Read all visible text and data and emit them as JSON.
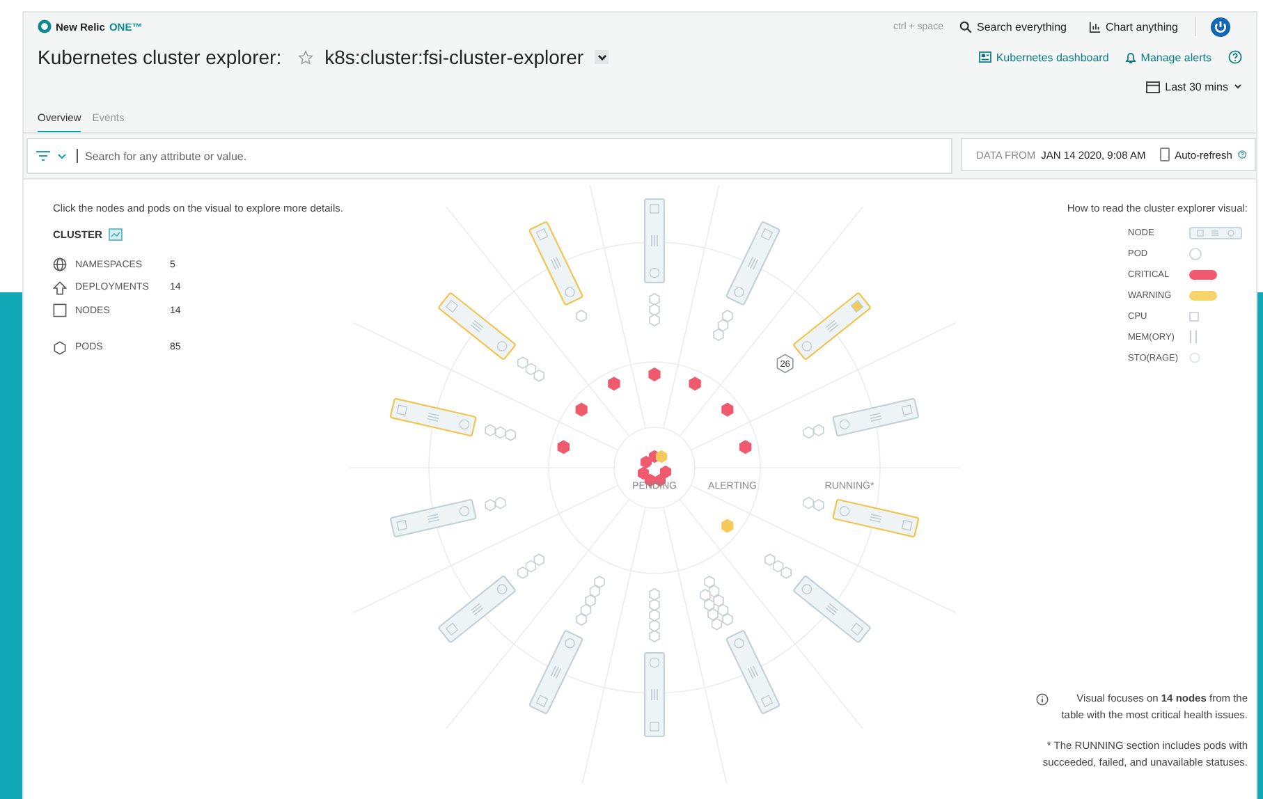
{
  "header": {
    "brand": "New Relic",
    "product": "ONE™",
    "shortcut": "ctrl + space",
    "search": "Search everything",
    "chart": "Chart anything"
  },
  "title": {
    "label": "Kubernetes cluster explorer:",
    "entity": "k8s:cluster:fsi-cluster-explorer",
    "starred": false
  },
  "links": [
    "Kubernetes dashboard",
    "Manage alerts"
  ],
  "time_range": "Last 30 mins",
  "tabs": [
    {
      "label": "Overview",
      "selected": true
    },
    {
      "label": "Events",
      "selected": false
    }
  ],
  "filter": {
    "placeholder": "Search for any attribute or value."
  },
  "data_from": {
    "label": "DATA FROM",
    "value": "JAN 14 2020, 9:08 AM"
  },
  "auto_refresh": {
    "label": "Auto-refresh",
    "checked": false
  },
  "intro": "Click the nodes and pods on the visual to explore more details.",
  "cluster": {
    "title": "CLUSTER",
    "stats": [
      {
        "kind": "namespaces",
        "label": "NAMESPACES",
        "value": "5"
      },
      {
        "kind": "deployments",
        "label": "DEPLOYMENTS",
        "value": "14"
      },
      {
        "kind": "nodes",
        "label": "NODES",
        "value": "14"
      },
      {
        "kind": "pods",
        "label": "PODS",
        "value": "85"
      }
    ]
  },
  "diagram": {
    "sections": [
      "PENDING",
      "ALERTING",
      "RUNNING*"
    ],
    "nodes": [
      {
        "warning": false,
        "cpu_alert": false,
        "critical_pod": true
      },
      {
        "warning": false,
        "cpu_alert": false,
        "critical_pod": true
      },
      {
        "warning": true,
        "cpu_alert": true,
        "critical_pod": true,
        "badge": "26"
      },
      {
        "warning": false,
        "cpu_alert": false,
        "critical_pod": true
      },
      {
        "warning": true,
        "cpu_alert": false
      },
      {
        "warning": false,
        "cpu_alert": false,
        "warning_pod": true
      },
      {
        "warning": false,
        "cpu_alert": false
      },
      {
        "warning": false,
        "cpu_alert": false
      },
      {
        "warning": false,
        "cpu_alert": false
      },
      {
        "warning": false,
        "cpu_alert": false
      },
      {
        "warning": false,
        "cpu_alert": false
      },
      {
        "warning": true,
        "cpu_alert": false,
        "critical_pod": true
      },
      {
        "warning": true,
        "cpu_alert": false,
        "critical_pod": true
      },
      {
        "warning": true,
        "cpu_alert": false,
        "critical_pod": true
      }
    ]
  },
  "legend": {
    "title": "How to read the cluster explorer visual:",
    "items": [
      {
        "kind": "node",
        "label": "NODE"
      },
      {
        "kind": "pod",
        "label": "POD"
      },
      {
        "kind": "critical",
        "label": "CRITICAL"
      },
      {
        "kind": "warning",
        "label": "WARNING"
      },
      {
        "kind": "cpu",
        "label": "CPU"
      },
      {
        "kind": "memory",
        "label": "MEM(ORY)"
      },
      {
        "kind": "storage",
        "label": "STO(RAGE)"
      }
    ]
  },
  "notes": [
    {
      "kind": "info",
      "text": "Visual focuses on **14 nodes** from the table with the most critical health issues."
    },
    {
      "kind": "plain",
      "text": "* The RUNNING section includes pods with succeeded, failed, and unavailable statuses."
    }
  ]
}
